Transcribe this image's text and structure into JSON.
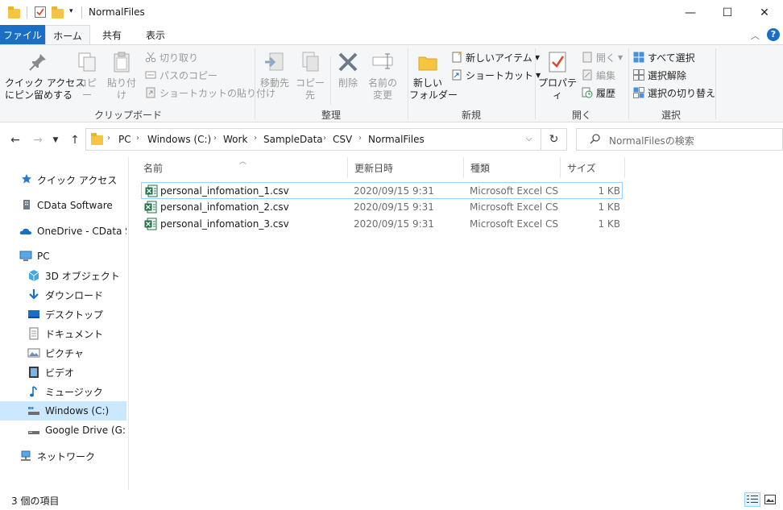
{
  "window": {
    "title": "NormalFiles",
    "minimize": "—",
    "maximize": "☐",
    "close": "✕"
  },
  "ribbon_tabs": [
    {
      "label": "ファイル"
    },
    {
      "label": "ホーム"
    },
    {
      "label": "共有"
    },
    {
      "label": "表示"
    }
  ],
  "ribbon": {
    "clipboard": {
      "pin": "クイック アクセス\nにピン留めする",
      "copy": "コピー",
      "paste": "貼り付け",
      "cut": "切り取り",
      "copy_path": "パスのコピー",
      "paste_shortcut": "ショートカットの貼り付け",
      "label": "クリップボード"
    },
    "organize": {
      "move_to": "移動先",
      "copy_to": "コピー先",
      "delete": "削除",
      "rename": "名前の\n変更",
      "label": "整理"
    },
    "new": {
      "new_folder": "新しい\nフォルダー",
      "new_item": "新しいアイテム",
      "shortcut": "ショートカット",
      "label": "新規"
    },
    "open": {
      "properties": "プロパティ",
      "open": "開く",
      "edit": "編集",
      "history": "履歴",
      "label": "開く"
    },
    "select": {
      "select_all": "すべて選択",
      "select_none": "選択解除",
      "invert": "選択の切り替え",
      "label": "選択"
    }
  },
  "address": {
    "crumbs": [
      "PC",
      "Windows (C:)",
      "Work",
      "SampleData",
      "CSV",
      "NormalFiles"
    ],
    "search_placeholder": "NormalFilesの検索"
  },
  "nav": [
    {
      "label": "クイック アクセス",
      "icon": "star-icon"
    },
    {
      "label": "CData Software",
      "icon": "building-icon"
    },
    {
      "label": "OneDrive - CData Sof",
      "icon": "cloud-icon"
    },
    {
      "label": "PC",
      "icon": "pc-icon"
    },
    {
      "label": "3D オブジェクト",
      "icon": "cube-icon"
    },
    {
      "label": "ダウンロード",
      "icon": "download-icon"
    },
    {
      "label": "デスクトップ",
      "icon": "desktop-icon"
    },
    {
      "label": "ドキュメント",
      "icon": "document-icon"
    },
    {
      "label": "ピクチャ",
      "icon": "picture-icon"
    },
    {
      "label": "ビデオ",
      "icon": "video-icon"
    },
    {
      "label": "ミュージック",
      "icon": "music-icon"
    },
    {
      "label": "Windows (C:)",
      "icon": "drive-icon"
    },
    {
      "label": "Google Drive (G:)",
      "icon": "drive-icon"
    },
    {
      "label": "ネットワーク",
      "icon": "network-icon"
    }
  ],
  "columns": {
    "name": "名前",
    "modified": "更新日時",
    "type": "種類",
    "size": "サイズ"
  },
  "files": [
    {
      "name": "personal_infomation_1.csv",
      "modified": "2020/09/15 9:31",
      "type": "Microsoft Excel CS...",
      "size": "1 KB"
    },
    {
      "name": "personal_infomation_2.csv",
      "modified": "2020/09/15 9:31",
      "type": "Microsoft Excel CS...",
      "size": "1 KB"
    },
    {
      "name": "personal_infomation_3.csv",
      "modified": "2020/09/15 9:31",
      "type": "Microsoft Excel CS...",
      "size": "1 KB"
    }
  ],
  "status": {
    "count": "3 個の項目"
  },
  "colors": {
    "accent": "#1a6fc4",
    "selected": "#cce8ff",
    "excel": "#1e7145"
  }
}
